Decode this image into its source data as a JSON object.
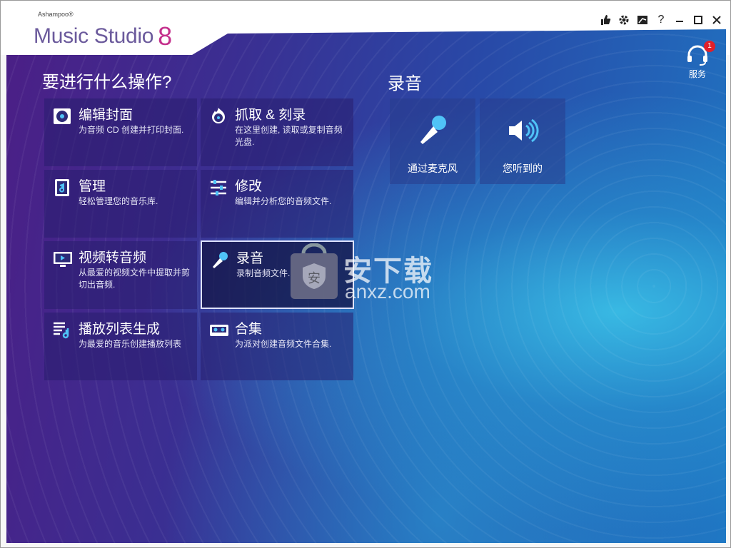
{
  "app": {
    "brand": "Ashampoo®",
    "name": "Music Studio",
    "version": "8"
  },
  "window_controls": {
    "help": "?"
  },
  "service": {
    "badge": "1",
    "label": "服务"
  },
  "left_section": {
    "title": "要进行什么操作?",
    "tiles": [
      {
        "title": "编辑封面",
        "desc": "为音频 CD 创建并打印封面.",
        "icon": "cd-cover-icon"
      },
      {
        "title": "抓取 & 刻录",
        "desc": "在这里创建, 读取或复制音频光盘.",
        "icon": "disc-burn-icon"
      },
      {
        "title": "管理",
        "desc": "轻松管理您的音乐库.",
        "icon": "music-library-icon"
      },
      {
        "title": "修改",
        "desc": "编辑并分析您的音频文件.",
        "icon": "sliders-icon"
      },
      {
        "title": "视频转音频",
        "desc": "从最爱的视频文件中提取并剪切出音频.",
        "icon": "video-monitor-icon"
      },
      {
        "title": "录音",
        "desc": "录制音频文件.",
        "icon": "microphone-icon"
      },
      {
        "title": "播放列表生成",
        "desc": "为最爱的音乐创建播放列表",
        "icon": "playlist-icon"
      },
      {
        "title": "合集",
        "desc": "为派对创建音频文件合集.",
        "icon": "cassette-icon"
      }
    ]
  },
  "right_section": {
    "title": "录音",
    "tiles": [
      {
        "label": "通过麦克风",
        "icon": "microphone-icon"
      },
      {
        "label": "您听到的",
        "icon": "speaker-icon"
      }
    ]
  },
  "watermark": {
    "text": "安下载",
    "sub": "anxz.com",
    "badge": "安"
  }
}
